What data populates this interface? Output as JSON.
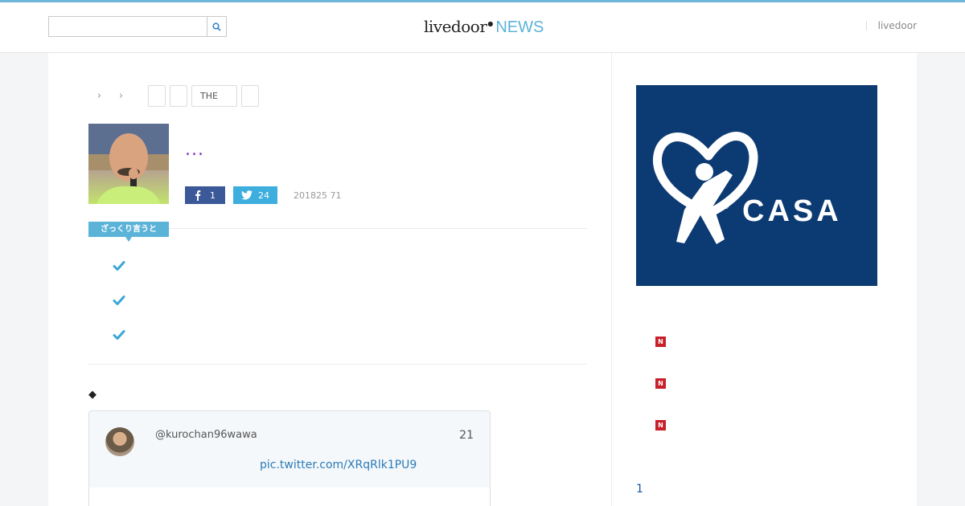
{
  "header": {
    "search": {
      "value": "",
      "placeholder": ""
    },
    "logo": {
      "main": "livedoor",
      "dot": "●",
      "news": "NEWS"
    },
    "right_link": "livedoor"
  },
  "article": {
    "breadcrumb_separators": [
      "›",
      "›"
    ],
    "tags": [
      "",
      "",
      "THE",
      ""
    ],
    "headline": "...",
    "share": {
      "facebook_count": "1",
      "twitter_count": "24"
    },
    "date": "201825 71",
    "summary_label": "ざっくり言うと",
    "section_marker": "◆"
  },
  "tweet": {
    "username": "@kurochan96wawa",
    "time": "21",
    "link": "pic.twitter.com/XRqRlk1PU9"
  },
  "sidebar": {
    "ad": {
      "brand": "CASA",
      "background": "#0c3a72"
    },
    "news_badge": "N",
    "page_number": "1"
  },
  "colors": {
    "accent": "#5cb3d8",
    "facebook": "#3b5998",
    "twitter": "#3eaede",
    "new_badge": "#c8202b",
    "headline": "#7b2fbe"
  }
}
